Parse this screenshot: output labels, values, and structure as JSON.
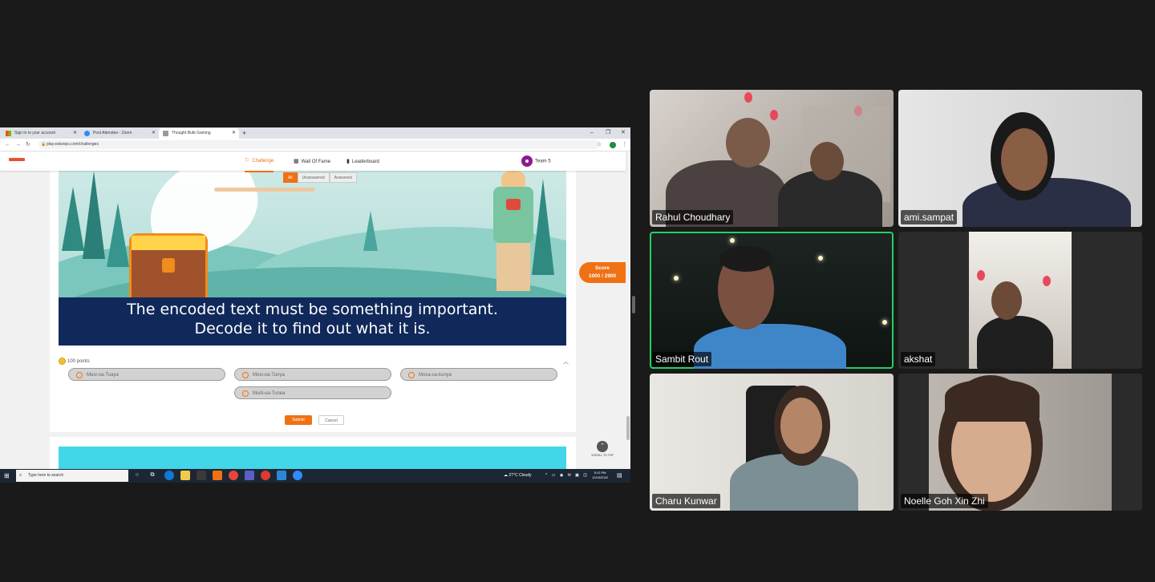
{
  "browser": {
    "tabs": [
      {
        "label": "Sign in to your account",
        "icon": "microsoft-logo-icon",
        "active": false
      },
      {
        "label": "Post Attendee - Zoom",
        "icon": "zoom-logo-icon",
        "active": false
      },
      {
        "label": "Thought Bulb Gaming",
        "icon": "site-favicon-icon",
        "active": true
      }
    ],
    "url": "play.eskoops.com/challenges"
  },
  "site": {
    "nav": [
      {
        "label": "Challenge",
        "icon": "flag-icon",
        "active": true
      },
      {
        "label": "Wall Of Fame",
        "icon": "grid-icon",
        "active": false
      },
      {
        "label": "Leaderboard",
        "icon": "bar-chart-icon",
        "active": false
      }
    ],
    "team": "Team 5",
    "filters": [
      "All",
      "Unanswered",
      "Answered"
    ],
    "question": {
      "line1": "The encoded text must be something important.",
      "line2": "Decode it to find out what it is.",
      "points": "100 points",
      "options": [
        "Mesi-oa-Tuaya",
        "Mosi-oa-Tunya",
        "Mosa-sa-kunya",
        "Modi-oa-Tunea"
      ],
      "submit": "Submit",
      "cancel": "Cancel"
    },
    "score": {
      "label": "Score",
      "value": "1000 / 2900"
    },
    "scroll_top": "SCROLL TO TOP"
  },
  "taskbar": {
    "search_placeholder": "Type here to search",
    "weather": "27°C  Cloudy",
    "time": "5:12 PM",
    "date": "12/16/2022"
  },
  "participants": [
    {
      "name": "Rahul Choudhary"
    },
    {
      "name": "ami.sampat"
    },
    {
      "name": "Sambit Rout",
      "active_speaker": true
    },
    {
      "name": "akshat"
    },
    {
      "name": "Charu Kunwar"
    },
    {
      "name": "Noelle Goh Xin Zhi"
    }
  ],
  "colors": {
    "accent": "#f07114",
    "speaker_border": "#23d160",
    "banner": "#10295a"
  }
}
